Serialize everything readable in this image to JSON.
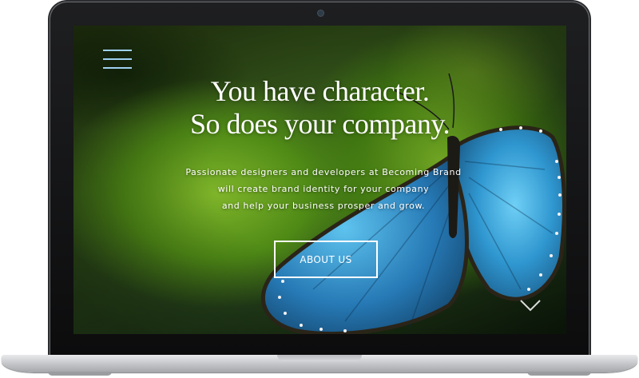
{
  "hero": {
    "headline_line1": "You have character.",
    "headline_line2": "So does your company.",
    "description_line1": "Passionate designers and developers at Becoming Brand",
    "description_line2": "will create brand identity for your company",
    "description_line3": "and help your business prosper and grow.",
    "cta_label": "ABOUT US"
  },
  "icons": {
    "menu": "hamburger-menu-icon",
    "scroll": "chevron-down-icon"
  },
  "colors": {
    "menu_accent": "#9fd0f2",
    "text": "#ffffff",
    "butterfly_blue": "#3aa9dc"
  }
}
